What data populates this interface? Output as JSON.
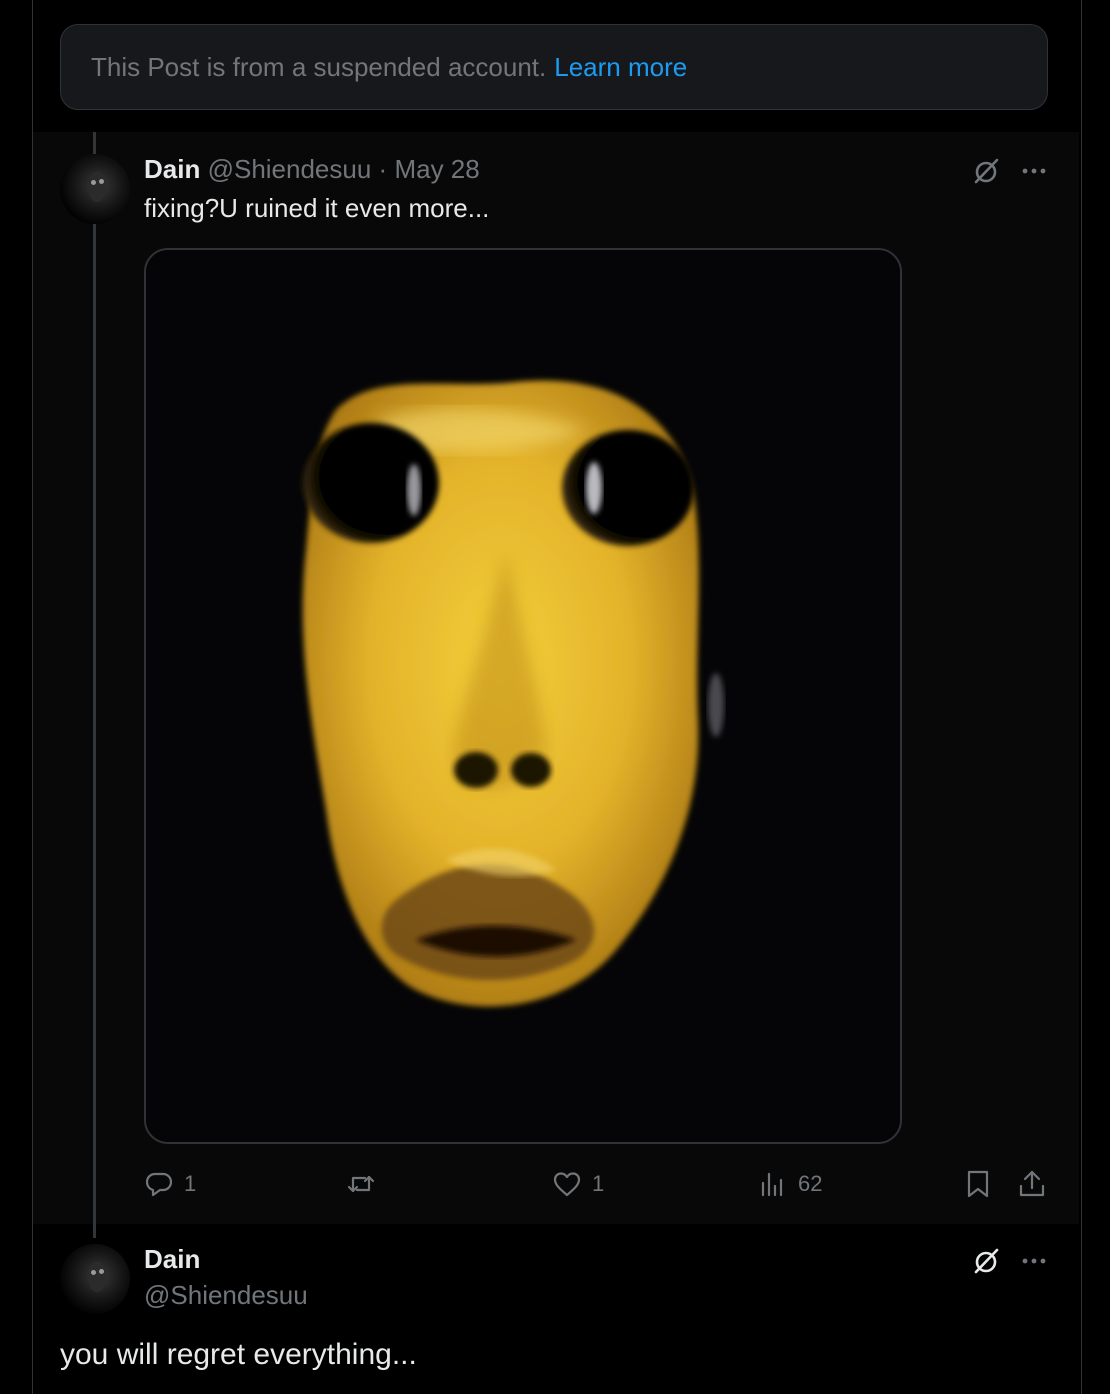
{
  "notice": {
    "text": "This Post is from a suspended account.",
    "link": "Learn more"
  },
  "quoted_post": {
    "author_name": "Dain",
    "handle": "@Shiendesuu",
    "separator": "·",
    "date": "May 28",
    "text": "fixing?U ruined it even more...",
    "media_icon": "distorted-yellow-face-image",
    "actions": {
      "replies": "1",
      "reposts": "",
      "likes": "1",
      "views": "62"
    }
  },
  "main_post": {
    "author_name": "Dain",
    "handle": "@Shiendesuu",
    "text": "you will regret everything..."
  },
  "colors": {
    "background": "#000000",
    "card": "#16181c",
    "border": "#2f3336",
    "muted": "#71767b",
    "link": "#1d9bf0",
    "text": "#e7e9ea",
    "face": "#e8b92a"
  },
  "icons": {
    "more": "more-horizontal-icon",
    "grok": "grok-icon",
    "reply": "reply-icon",
    "repost": "repost-icon",
    "like": "heart-icon",
    "views": "analytics-icon",
    "bookmark": "bookmark-icon",
    "share": "share-icon"
  }
}
